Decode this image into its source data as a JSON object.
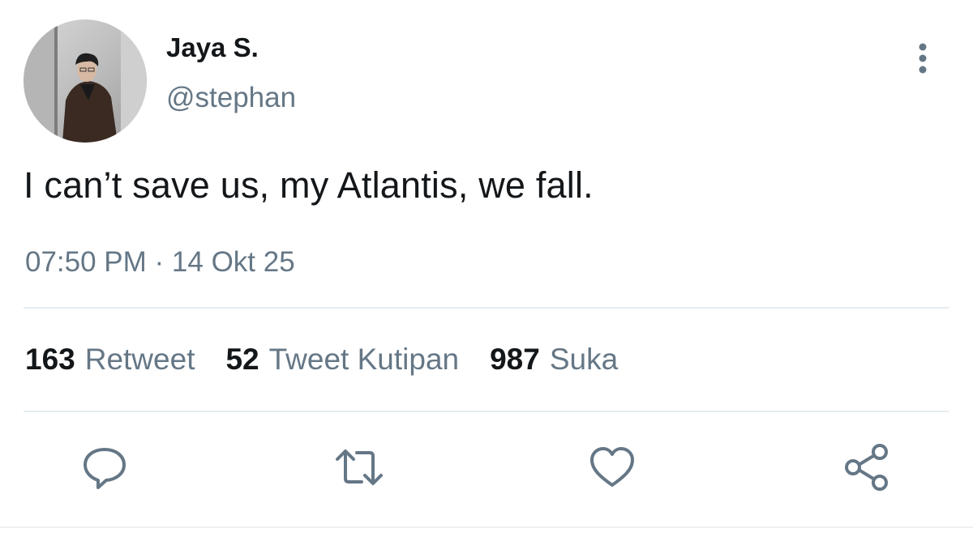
{
  "user": {
    "display_name": "Jaya S.",
    "handle": "@stephan"
  },
  "tweet": {
    "text": "I can’t save us, my Atlantis, we fall.",
    "timestamp": "07:50 PM · 14 Okt 25"
  },
  "stats": [
    {
      "count": "163",
      "label": "Retweet"
    },
    {
      "count": "52",
      "label": "Tweet Kutipan"
    },
    {
      "count": "987",
      "label": "Suka"
    }
  ],
  "actions": {
    "reply_icon": "speech-bubble-icon",
    "retweet_icon": "retweet-arrows-icon",
    "like_icon": "heart-icon",
    "share_icon": "share-nodes-icon"
  },
  "colors": {
    "primary_text": "#14171a",
    "secondary_text": "#657786",
    "divider": "#e6ecf0",
    "icon": "#657786"
  }
}
